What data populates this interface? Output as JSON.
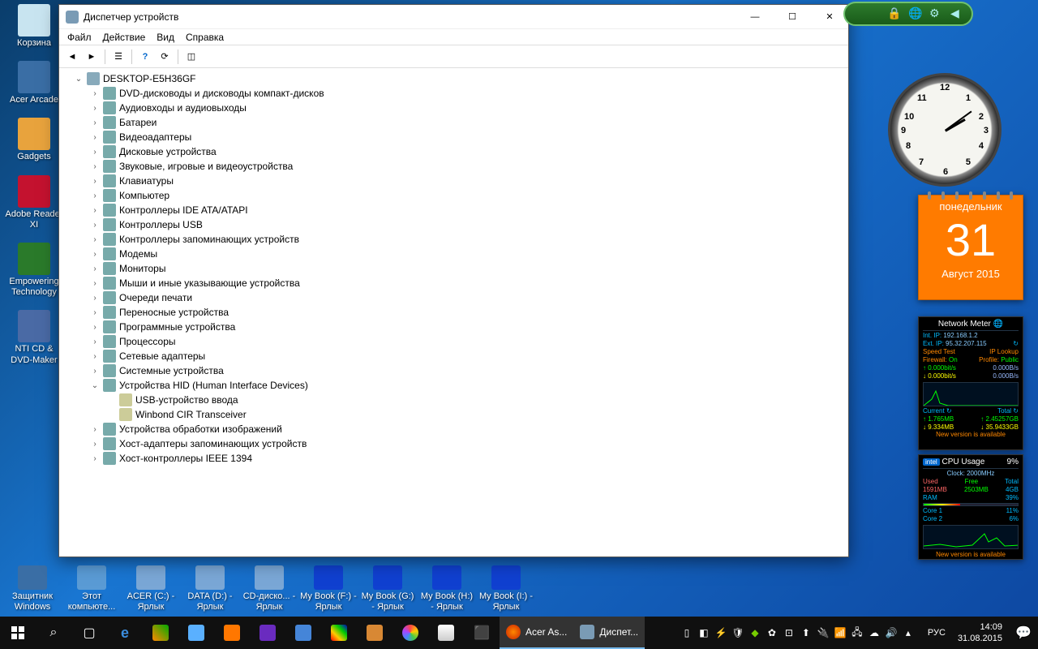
{
  "desktop": {
    "icons_left": [
      {
        "label": "Корзина",
        "color": "#c8e4f0"
      },
      {
        "label": "Acer Arcade",
        "color": "#3a6ea5"
      },
      {
        "label": "Gadgets",
        "color": "#e8a33d"
      },
      {
        "label": "Adobe Reader XI",
        "color": "#c4122f"
      },
      {
        "label": "Empowering Technology",
        "color": "#2a7a2a"
      },
      {
        "label": "NTI CD & DVD-Maker",
        "color": "#4a6aa5"
      }
    ],
    "icons_bottom": [
      {
        "label": "Защитник Windows",
        "color": "#3a6ea5"
      },
      {
        "label": "Этот компьюте...",
        "color": "#5a9bd5"
      },
      {
        "label": "ACER (C:) - Ярлык",
        "color": "#7aa7d6"
      },
      {
        "label": "DATA (D:) - Ярлык",
        "color": "#7aa7d6"
      },
      {
        "label": "CD-диско...  - Ярлык",
        "color": "#7aa7d6"
      },
      {
        "label": "My Book (F:) - Ярлык",
        "color": "#1040d0"
      },
      {
        "label": "My Book (G:) - Ярлык",
        "color": "#1040d0"
      },
      {
        "label": "My Book (H:) - Ярлык",
        "color": "#1040d0"
      },
      {
        "label": "My Book (I:) - Ярлык",
        "color": "#1040d0"
      }
    ]
  },
  "window": {
    "title": "Диспетчер устройств",
    "menu": [
      "Файл",
      "Действие",
      "Вид",
      "Справка"
    ],
    "root": "DESKTOP-E5H36GF",
    "categories": [
      {
        "label": "DVD-дисководы и дисководы компакт-дисков",
        "expanded": false
      },
      {
        "label": "Аудиовходы и аудиовыходы",
        "expanded": false
      },
      {
        "label": "Батареи",
        "expanded": false
      },
      {
        "label": "Видеоадаптеры",
        "expanded": false
      },
      {
        "label": "Дисковые устройства",
        "expanded": false
      },
      {
        "label": "Звуковые, игровые и видеоустройства",
        "expanded": false
      },
      {
        "label": "Клавиатуры",
        "expanded": false
      },
      {
        "label": "Компьютер",
        "expanded": false
      },
      {
        "label": "Контроллеры IDE ATA/ATAPI",
        "expanded": false
      },
      {
        "label": "Контроллеры USB",
        "expanded": false
      },
      {
        "label": "Контроллеры запоминающих устройств",
        "expanded": false
      },
      {
        "label": "Модемы",
        "expanded": false
      },
      {
        "label": "Мониторы",
        "expanded": false
      },
      {
        "label": "Мыши и иные указывающие устройства",
        "expanded": false
      },
      {
        "label": "Очереди печати",
        "expanded": false
      },
      {
        "label": "Переносные устройства",
        "expanded": false
      },
      {
        "label": "Программные устройства",
        "expanded": false
      },
      {
        "label": "Процессоры",
        "expanded": false
      },
      {
        "label": "Сетевые адаптеры",
        "expanded": false
      },
      {
        "label": "Системные устройства",
        "expanded": false
      },
      {
        "label": "Устройства HID (Human Interface Devices)",
        "expanded": true,
        "children": [
          {
            "label": "USB-устройство ввода"
          },
          {
            "label": "Winbond CIR Transceiver"
          }
        ]
      },
      {
        "label": "Устройства обработки изображений",
        "expanded": false
      },
      {
        "label": "Хост-адаптеры запоминающих устройств",
        "expanded": false
      },
      {
        "label": "Хост-контроллеры IEEE 1394",
        "expanded": false
      }
    ]
  },
  "calendar": {
    "dow": "понедельник",
    "day": "31",
    "month_year": "Август 2015"
  },
  "clock": {
    "hour": 2,
    "minute": 9,
    "numbers": [
      "12",
      "1",
      "2",
      "3",
      "4",
      "5",
      "6",
      "7",
      "8",
      "9",
      "10",
      "11"
    ]
  },
  "netmeter": {
    "title": "Network Meter",
    "int_ip_label": "Int. IP:",
    "int_ip": "192.168.1.2",
    "ext_ip_label": "Ext. IP:",
    "ext_ip": "95.32.207.115",
    "speed_test": "Speed Test",
    "ip_lookup": "IP Lookup",
    "firewall_label": "Firewall:",
    "firewall": "On",
    "profile_label": "Profile:",
    "profile": "Public",
    "up_rate": "0.000bit/s",
    "dn_rate": "0.000B/s",
    "up_rate2": "0.000bit/s",
    "dn_rate2": "0.000B/s",
    "current_label": "Current",
    "total_label": "Total",
    "cur_up": "1.765MB",
    "tot_up": "2.45257GB",
    "cur_dn": "9.334MB",
    "tot_dn": "35.9433GB",
    "warn": "New version is available"
  },
  "cpumeter": {
    "title": "CPU Usage",
    "pct": "9%",
    "clock_label": "Clock:",
    "clock": "2000MHz",
    "used_label": "Used",
    "free_label": "Free",
    "total_label": "Total",
    "used": "1591MB",
    "free": "2503MB",
    "total": "4GB",
    "ram_label": "RAM",
    "ram_pct": "39%",
    "core1_label": "Core 1",
    "core1": "11%",
    "core2_label": "Core 2",
    "core2": "6%",
    "warn": "New version is available"
  },
  "taskbar": {
    "app1": "Acer As...",
    "app2": "Диспет...",
    "lang": "РУС",
    "time": "14:09",
    "date": "31.08.2015"
  }
}
